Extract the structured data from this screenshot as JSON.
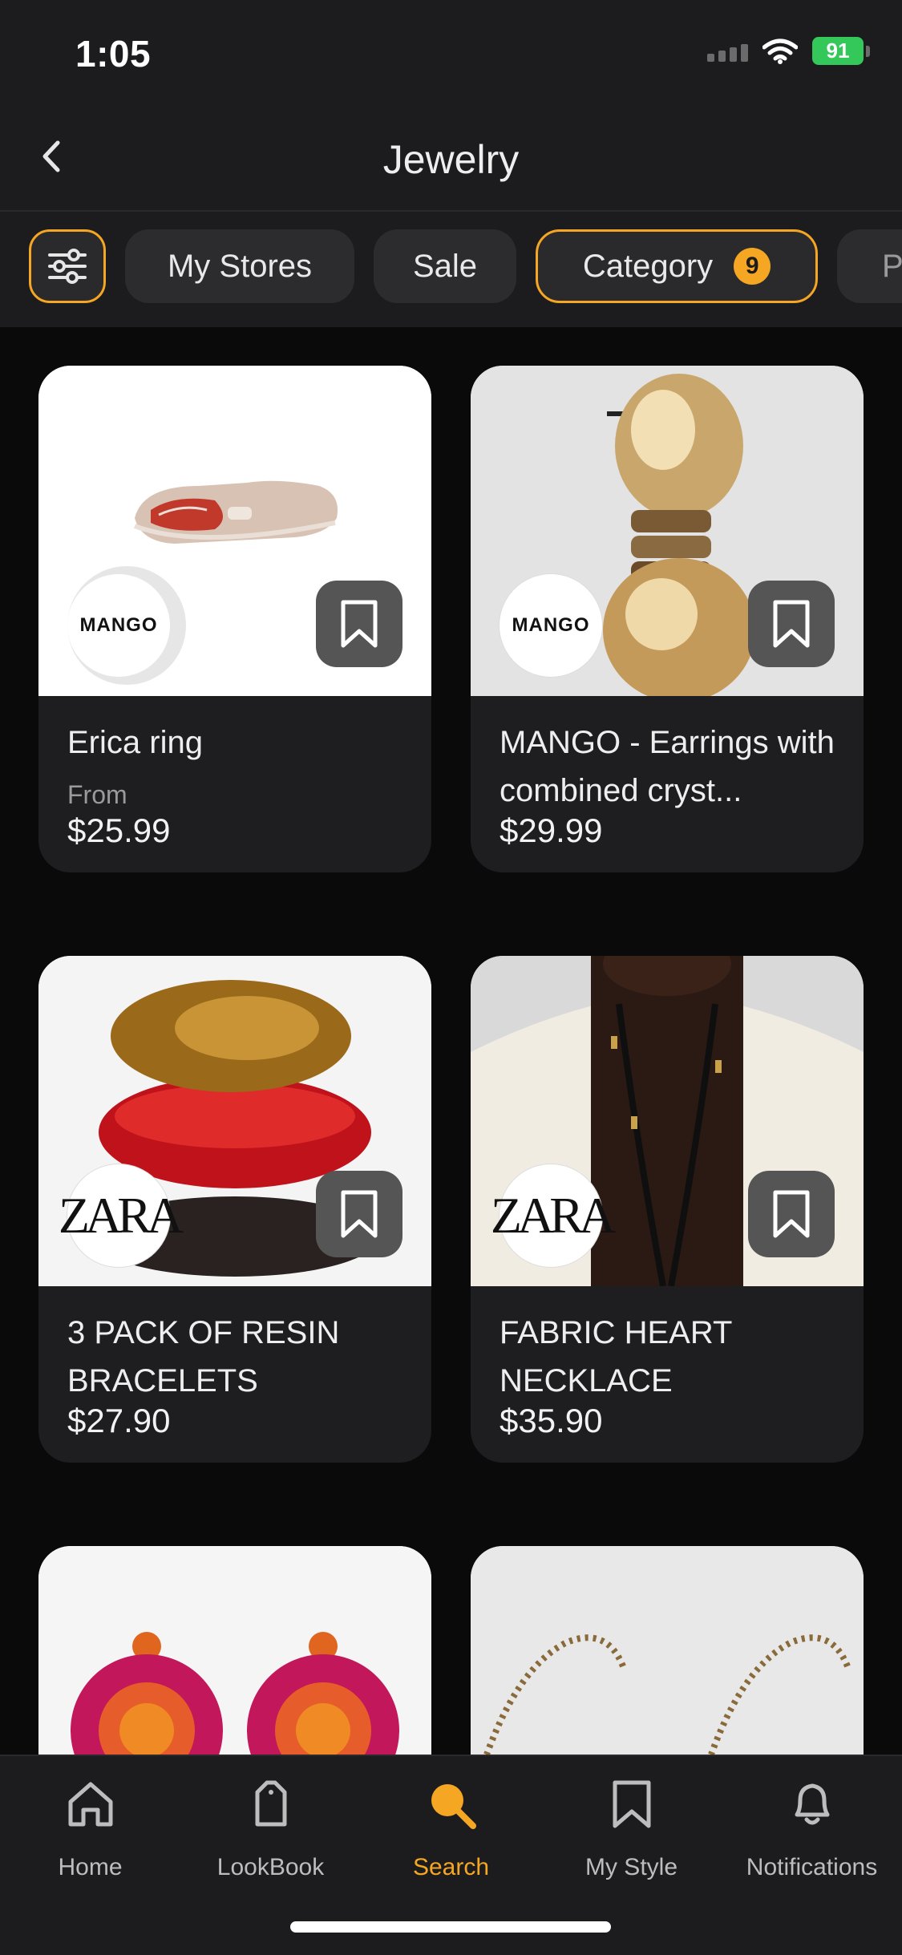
{
  "status": {
    "time": "1:05",
    "battery": "91"
  },
  "nav": {
    "title": "Jewelry"
  },
  "filters": {
    "chips": [
      "My Stores",
      "Sale",
      "Category",
      "P"
    ],
    "category_count": "9"
  },
  "products": [
    {
      "title": "Erica ring",
      "from": "From",
      "price": "$25.99",
      "brand": "MANGO"
    },
    {
      "title": "MANGO - Earrings with combined cryst...",
      "price": "$29.99",
      "brand": "MANGO"
    },
    {
      "title": "3 PACK OF RESIN BRACELETS",
      "price": "$27.90",
      "brand": "ZARA"
    },
    {
      "title": "FABRIC HEART NECKLACE",
      "price": "$35.90",
      "brand": "ZARA"
    }
  ],
  "tabs": [
    "Home",
    "LookBook",
    "Search",
    "My Style",
    "Notifications"
  ],
  "colors": {
    "accent": "#f5a623",
    "background": "#0a0a0b",
    "surface": "#1c1c1e",
    "battery": "#34c759"
  },
  "icons": [
    "back-icon",
    "filter-sliders-icon",
    "bookmark-icon",
    "home-icon",
    "lookbook-bag-icon",
    "search-icon",
    "my-style-bookmark-icon",
    "bell-icon",
    "wifi-icon",
    "signal-icon",
    "battery-icon"
  ]
}
